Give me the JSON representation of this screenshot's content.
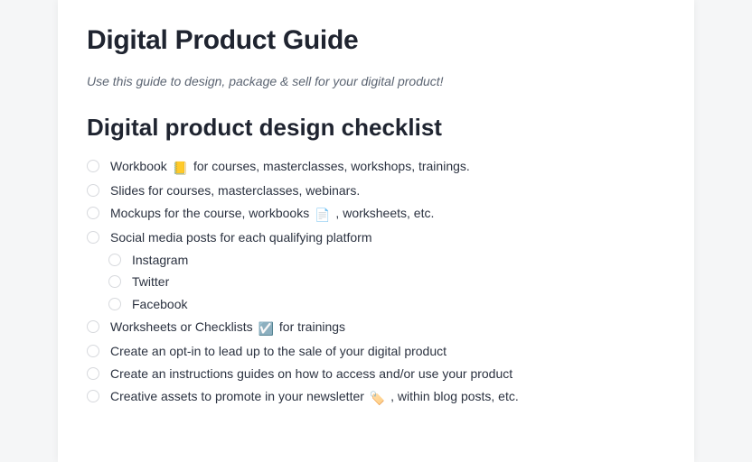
{
  "title": "Digital Product Guide",
  "intro": "Use this guide to design, package & sell for your digital product!",
  "section_heading": "Digital product design checklist",
  "checklist": [
    {
      "prefix": "Workbook ",
      "icon": "📒",
      "suffix": " for courses, masterclasses, workshops, trainings.",
      "level": 0
    },
    {
      "prefix": "Slides for courses, masterclasses, webinars.",
      "icon": "",
      "suffix": "",
      "level": 0
    },
    {
      "prefix": "Mockups for the course, workbooks ",
      "icon": "📄",
      "suffix": " , worksheets, etc.",
      "level": 0
    },
    {
      "prefix": "Social media posts for each qualifying platform",
      "icon": "",
      "suffix": "",
      "level": 0
    },
    {
      "prefix": "Instagram",
      "icon": "",
      "suffix": "",
      "level": 1
    },
    {
      "prefix": "Twitter",
      "icon": "",
      "suffix": "",
      "level": 1
    },
    {
      "prefix": "Facebook",
      "icon": "",
      "suffix": "",
      "level": 1
    },
    {
      "prefix": "Worksheets or Checklists ",
      "icon": "☑️",
      "suffix": " for trainings",
      "level": 0
    },
    {
      "prefix": "Create an opt-in to lead up to the sale of your digital product",
      "icon": "",
      "suffix": "",
      "level": 0
    },
    {
      "prefix": "Create an instructions guides on how to access and/or use your product",
      "icon": "",
      "suffix": "",
      "level": 0
    },
    {
      "prefix": "Creative assets to promote in your newsletter ",
      "icon": "🏷️",
      "suffix": " , within blog posts, etc.",
      "level": 0
    }
  ]
}
